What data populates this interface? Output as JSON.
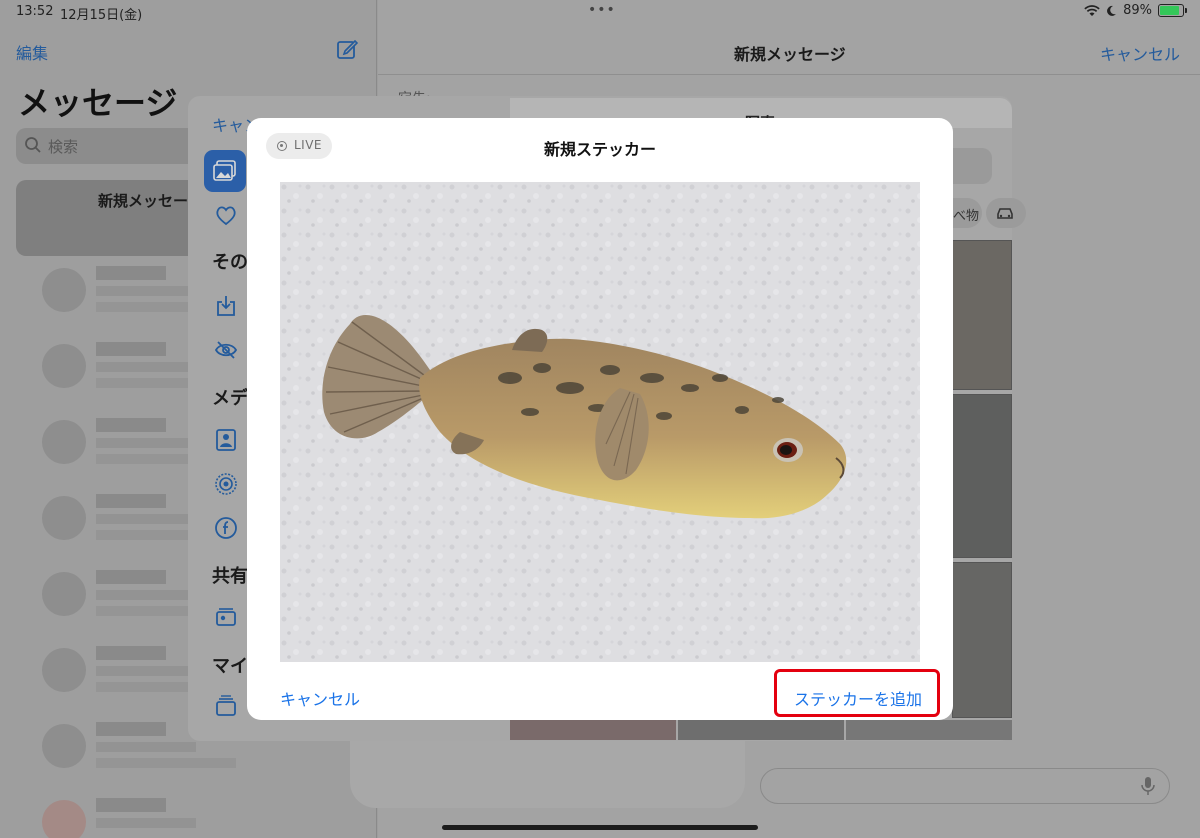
{
  "status_bar": {
    "time": "13:52",
    "date": "12月15日(金)",
    "battery": "89%",
    "battery_level": 0.89
  },
  "sidebar": {
    "edit_label": "編集",
    "title": "メッセージ",
    "search_placeholder": "検索",
    "new_message_label": "新規メッセージ"
  },
  "compose": {
    "title": "新規メッセージ",
    "cancel_label": "キャンセル",
    "to_label": "宛先:"
  },
  "picker": {
    "cancel_label": "キャンセル",
    "title": "写真",
    "section_other": "その他",
    "section_media": "メディア",
    "section_shared": "共有",
    "section_my": "マイ",
    "chip_label": "食べ物"
  },
  "sticker_modal": {
    "live_label": "LIVE",
    "title": "新規ステッカー",
    "cancel_label": "キャンセル",
    "add_label": "ステッカーを追加"
  },
  "colors": {
    "accent": "#1a73e8",
    "highlight": "#e4000f"
  }
}
